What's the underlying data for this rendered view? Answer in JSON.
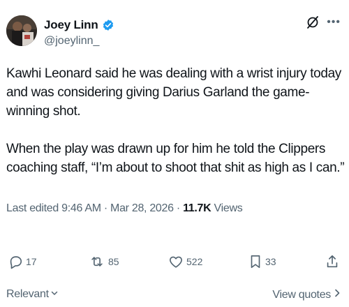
{
  "author": {
    "display_name": "Joey Linn",
    "handle": "@joeylinn_",
    "avatar_icon": "avatar-photo",
    "verified_icon": "verified-badge-icon",
    "verified_color": "#1d9bf0"
  },
  "header": {
    "grok_icon": "grok-icon",
    "more_label": "•••"
  },
  "tweet": {
    "paragraphs": [
      "Kawhi Leonard said he was dealing with a wrist injury today and was considering giving Darius Garland the game-winning shot.",
      "When the play was drawn up for him he told the Clippers coaching staff, “I’m about to shoot that shit as high as I can.”"
    ],
    "edited_label": "Last edited 9:46 AM · Mar 28, 2026 · ",
    "views_count": "11.7K",
    "views_label": " Views"
  },
  "actions": {
    "replies": "17",
    "reposts": "85",
    "likes": "522",
    "bookmarks": "33"
  },
  "footer": {
    "sort_label": "Relevant",
    "view_quotes_label": "View quotes"
  }
}
